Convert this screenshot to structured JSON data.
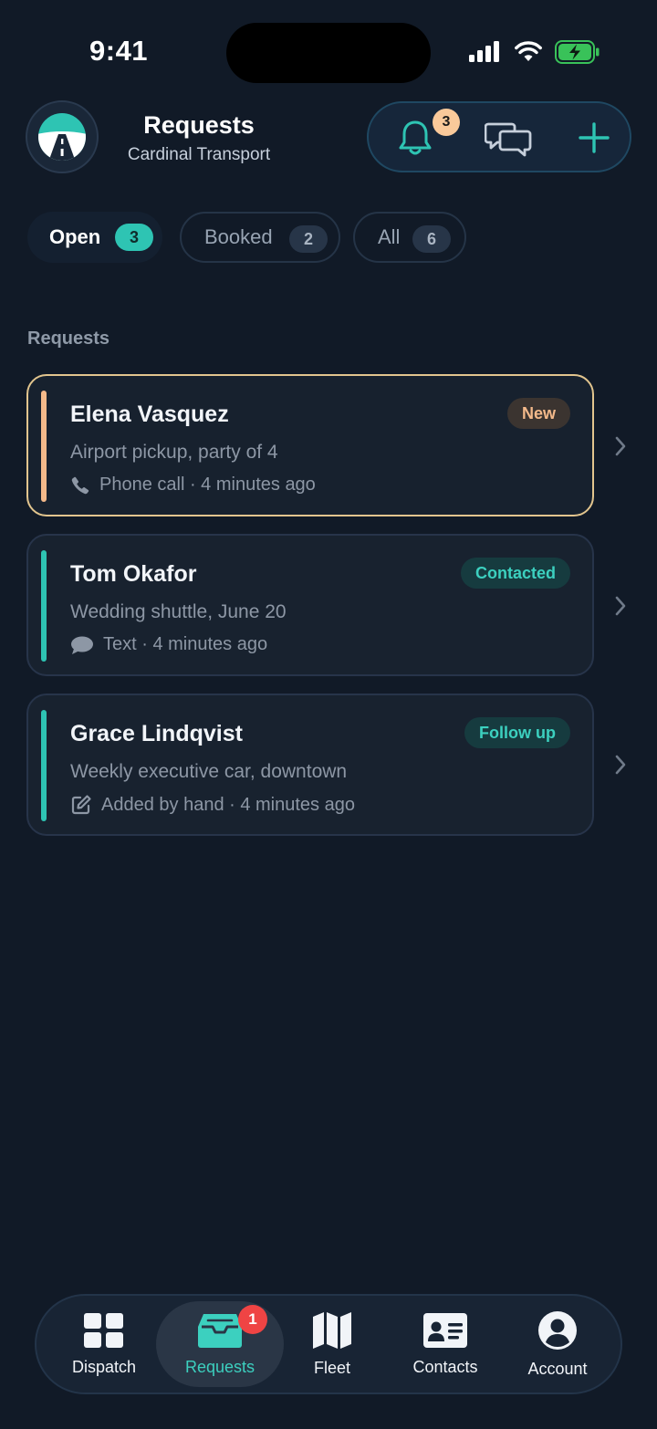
{
  "status_bar": {
    "time": "9:41"
  },
  "header": {
    "title": "Requests",
    "subtitle": "Cardinal Transport",
    "notifications_count": "3",
    "accent": "#2ec4b3"
  },
  "tabs": [
    {
      "label": "Open",
      "count": "3",
      "active": true
    },
    {
      "label": "Booked",
      "count": "2",
      "active": false
    },
    {
      "label": "All",
      "count": "6",
      "active": false
    }
  ],
  "section_label": "Requests",
  "requests": [
    {
      "name": "Elena Vasquez",
      "description": "Airport pickup, party of 4",
      "meta": "Phone call · 4 minutes ago",
      "meta_icon": "phone-icon",
      "badge": "New",
      "accent_color": "#f4b98a"
    },
    {
      "name": "Tom Okafor",
      "description": "Wedding shuttle, June 20",
      "meta": "Text · 4 minutes ago",
      "meta_icon": "message-icon",
      "badge": "Contacted",
      "accent_color": "#2ec4b3"
    },
    {
      "name": "Grace Lindqvist",
      "description": "Weekly executive car, downtown",
      "meta": "Added by hand · 4 minutes ago",
      "meta_icon": "edit-icon",
      "badge": "Follow up",
      "accent_color": "#2ec4b3"
    }
  ],
  "bottom_nav": [
    {
      "label": "Dispatch",
      "icon": "grid-icon",
      "active": false
    },
    {
      "label": "Requests",
      "icon": "inbox-icon",
      "active": true,
      "badge": "1"
    },
    {
      "label": "Fleet",
      "icon": "map-icon",
      "active": false
    },
    {
      "label": "Contacts",
      "icon": "contact-card-icon",
      "active": false
    },
    {
      "label": "Account",
      "icon": "account-icon",
      "active": false
    }
  ]
}
